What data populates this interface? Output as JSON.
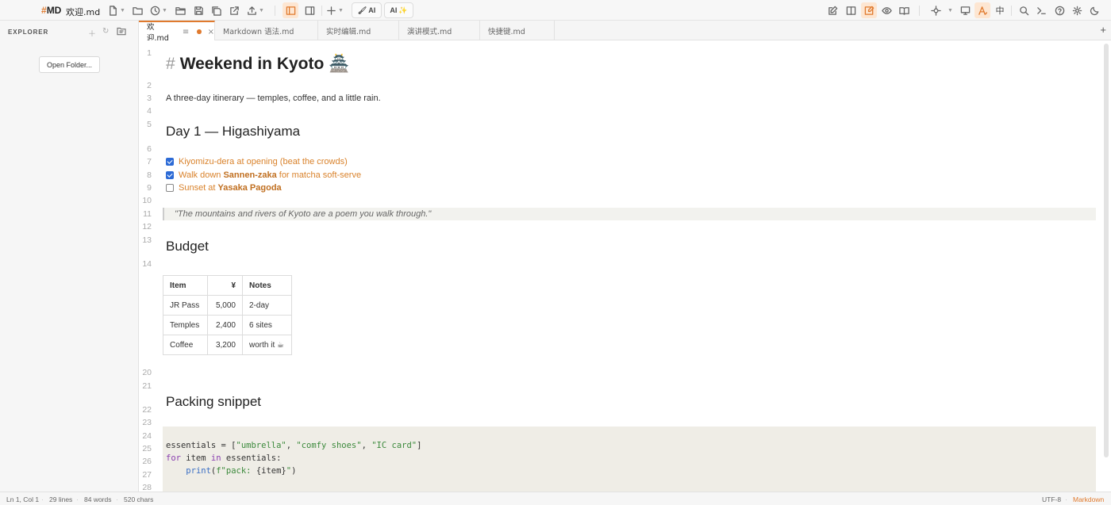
{
  "app": {
    "logo_mark": "#",
    "logo_text": "MD",
    "file_title": "欢迎.md"
  },
  "toolbar": {
    "ai_button_1": "AI",
    "ai_button_2": "AI",
    "ai_button_2_spark": "✨",
    "chinese_toggle": "中"
  },
  "explorer": {
    "title": "EXPLORER",
    "open_folder_label": "Open Folder..."
  },
  "tabs": [
    {
      "label": "欢迎.md",
      "active": true,
      "modified": true
    },
    {
      "label": "Markdown 语法.md"
    },
    {
      "label": "实时编辑.md"
    },
    {
      "label": "演讲模式.md"
    },
    {
      "label": "快捷键.md"
    }
  ],
  "editor": {
    "line_numbers": [
      "1",
      "2",
      "3",
      "4",
      "5",
      "6",
      "7",
      "8",
      "9",
      "10",
      "11",
      "12",
      "13",
      "14",
      "20",
      "21",
      "22",
      "23",
      "24",
      "25",
      "26",
      "27",
      "28"
    ],
    "h1_marker": "#",
    "h1_text": "Weekend in Kyoto 🏯",
    "intro": "A three-day itinerary — temples, coffee, and a little rain.",
    "day1_heading": "Day 1 — Higashiyama",
    "tasks": [
      {
        "checked": true,
        "pre": "Kiyomizu-dera at opening (beat the crowds)",
        "bold": "",
        "post": ""
      },
      {
        "checked": true,
        "pre": "Walk down ",
        "bold": "Sannen-zaka",
        "post": " for matcha soft-serve"
      },
      {
        "checked": false,
        "pre": "Sunset at ",
        "bold": "Yasaka Pagoda",
        "post": ""
      }
    ],
    "quote": "\"The mountains and rivers of Kyoto are a poem you walk through.\"",
    "budget_heading": "Budget",
    "budget_table": {
      "headers": [
        "Item",
        "¥",
        "Notes"
      ],
      "rows": [
        [
          "JR Pass",
          "5,000",
          "2-day"
        ],
        [
          "Temples",
          "2,400",
          "6 sites"
        ],
        [
          "Coffee",
          "3,200",
          "worth it ☕"
        ]
      ]
    },
    "snippet_heading": "Packing snippet",
    "code": {
      "l1_var": "essentials",
      "l1_op": " = [",
      "l1_s1": "\"umbrella\"",
      "l1_s2": "\"comfy shoes\"",
      "l1_s3": "\"IC card\"",
      "l1_end": "]",
      "l2_for": "for",
      "l2_mid": " item ",
      "l2_in": "in",
      "l2_end": " essentials:",
      "l3_fn": "print",
      "l3_open": "(",
      "l3_str": "f\"pack: ",
      "l3_interp": "{item}",
      "l3_close_str": "\"",
      "l3_close": ")"
    }
  },
  "status": {
    "position": "Ln 1, Col 1",
    "lines": "29 lines",
    "words": "84 words",
    "chars": "520 chars",
    "encoding": "UTF-8",
    "language": "Markdown",
    "separator": "·"
  }
}
